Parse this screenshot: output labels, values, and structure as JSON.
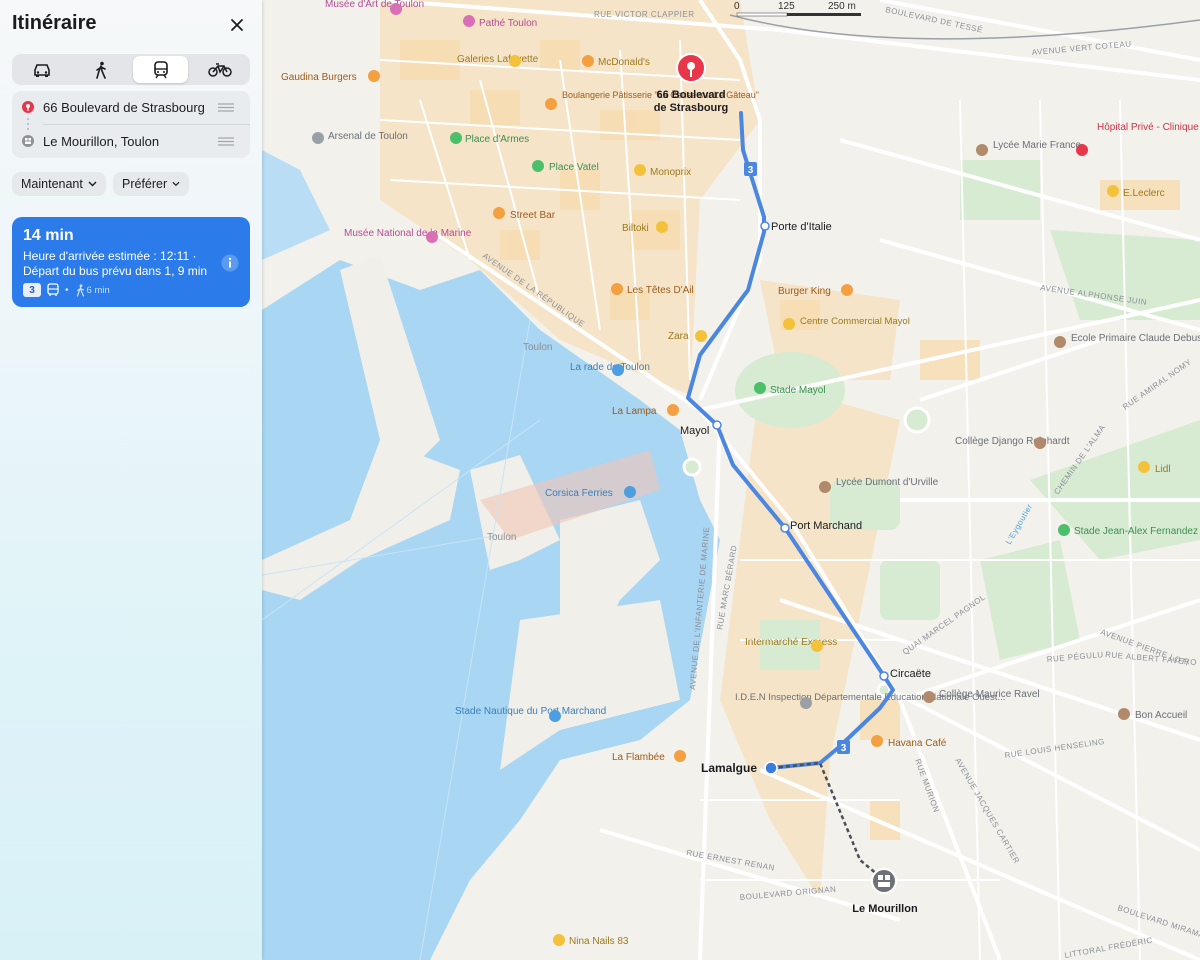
{
  "panel": {
    "title": "Itinéraire",
    "modes": [
      {
        "name": "car",
        "icon": "car-icon",
        "selected": false
      },
      {
        "name": "walk",
        "icon": "walk-icon",
        "selected": false
      },
      {
        "name": "transit",
        "icon": "transit-icon",
        "selected": true
      },
      {
        "name": "bike",
        "icon": "bike-icon",
        "selected": false
      }
    ],
    "origin": "66 Boulevard de Strasbourg",
    "destination": "Le Mourillon, Toulon",
    "when_label": "Maintenant",
    "prefer_label": "Préférer",
    "route": {
      "duration": "14 min",
      "eta_line1": "Heure d'arrivée estimée : 12:11 ·",
      "eta_line2": "Départ du bus prévu dans 1, 9 min",
      "line_number": "3",
      "walk_time": "6 min"
    }
  },
  "map": {
    "scale": {
      "zero": "0",
      "mid": "125",
      "end": "250 m"
    },
    "colors": {
      "route_blue": "#4b86e0",
      "pin_red": "#e8374b",
      "water": "#9fd0f1",
      "park": "#d8ecd4",
      "block_orange": "#f7e0bd"
    },
    "start_label_1": "66 Boulevard",
    "start_label_2": "de Strasbourg",
    "end_label": "Le Mourillon",
    "current_stop": "Lamalgue",
    "stops": [
      "Porte d'Italie",
      "Mayol",
      "Port Marchand",
      "Circaëte"
    ],
    "route_badge": "3",
    "streets": [
      "RUE VICTOR CLAPPIER",
      "BOULEVARD DE TESSÉ",
      "AVENUE VERT COTEAU",
      "AVENUE ALPHONSE JUIN",
      "AVENUE DE LA RÉPUBLIQUE",
      "AVENUE DE L'INFANTERIE DE MARINE",
      "RUE MARC BÉRARD",
      "QUAI MARCEL PAGNOL",
      "RUE ALBERT FAVERO",
      "AVENUE PIERRE LOTI",
      "RUE PÉGULU",
      "RUE LOUIS HENSELING",
      "AVENUE JACQUES CARTIER",
      "RUE MURION",
      "RUE ERNEST RENAN",
      "BOULEVARD ORIGNAN",
      "BOULEVARD MIRAMAR",
      "LITTORAL FRÉDÉRIC",
      "RUE AMIRAL NOMY",
      "CHEMIN DE L'ALMA",
      "L'Eygoutier"
    ],
    "pois": [
      "Musée d'Art de Toulon",
      "Pathé Toulon",
      "Galeries Lafayette",
      "McDonald's",
      "Gaudina Burgers",
      "Boulangerie Pâtisserie \"La Cerise sur Le Gâteau\"",
      "Arsenal de Toulon",
      "Place d'Armes",
      "Place Vatel",
      "Monoprix",
      "Street Bar",
      "Biltoki",
      "Musée National de la Marine",
      "Les Têtes D'Ail",
      "Burger King",
      "Centre Commercial Mayol",
      "Zara",
      "Toulon",
      "La rade de Toulon",
      "Stade Mayol",
      "La Lampa",
      "Corsica Ferries",
      "Toulon",
      "Lycée Dumont d'Urville",
      "Collège Django Reinhardt",
      "Lidl",
      "Stade Jean-Alex Fernandez",
      "Hôpital Privé - Clinique Saint Jean",
      "Lycée Marie France",
      "E.Leclerc",
      "Ecole Primaire Claude Debussy",
      "Intermarché Express",
      "I.D.E.N Inspection Départementale Education Nationale Ouest...",
      "Stade Nautique du Port Marchand",
      "La Flambée",
      "Havana Café",
      "Collège Maurice Ravel",
      "Bon Accueil",
      "Nina Nails 83"
    ]
  }
}
